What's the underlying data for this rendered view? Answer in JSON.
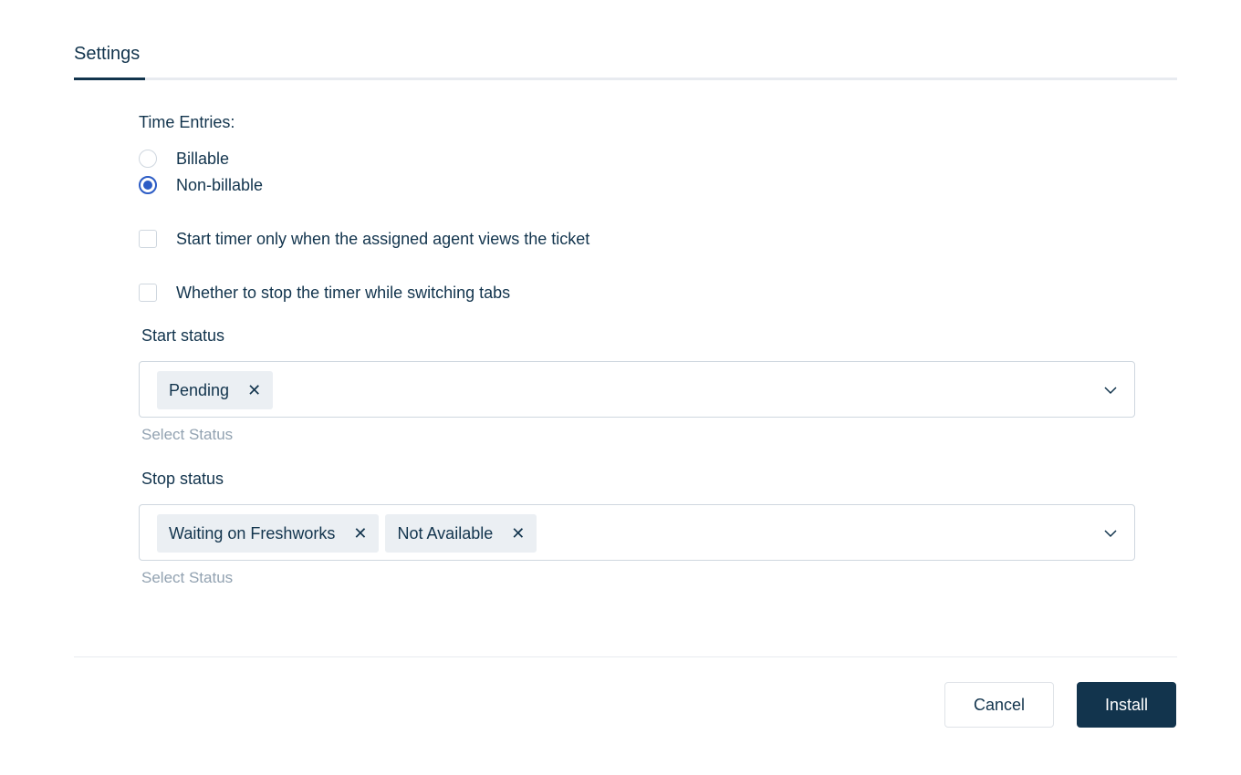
{
  "tabs": {
    "settings_label": "Settings"
  },
  "time_entries": {
    "label": "Time Entries:",
    "options": [
      {
        "label": "Billable",
        "selected": false
      },
      {
        "label": "Non-billable",
        "selected": true
      }
    ]
  },
  "checkboxes": {
    "start_timer_label": "Start timer only when the assigned agent views the ticket",
    "start_timer_checked": false,
    "stop_timer_label": "Whether to stop the timer while switching tabs",
    "stop_timer_checked": false
  },
  "start_status": {
    "label": "Start status",
    "selected": [
      "Pending"
    ],
    "hint": "Select Status"
  },
  "stop_status": {
    "label": "Stop status",
    "selected": [
      "Waiting on Freshworks",
      "Not Available"
    ],
    "hint": "Select Status"
  },
  "chip_remove_glyph": "✕",
  "footer": {
    "cancel_label": "Cancel",
    "install_label": "Install"
  },
  "colors": {
    "primary": "#12344d",
    "accent": "#2c5cc5",
    "muted": "#92a2b1",
    "border": "#cfd7df",
    "chip_bg": "#ebeff3"
  }
}
